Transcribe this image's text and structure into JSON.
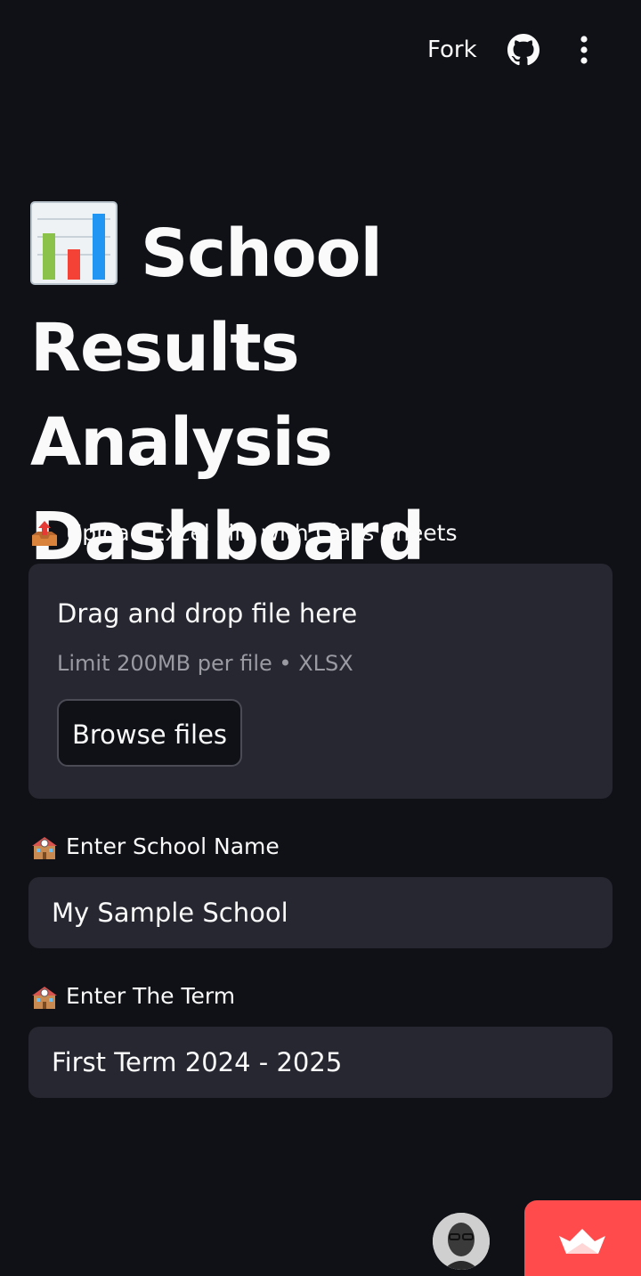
{
  "toolbar": {
    "fork_label": "Fork",
    "github_icon": "github-icon",
    "menu_icon": "kebab-menu-icon"
  },
  "title": {
    "icon": "bar-chart-icon",
    "text": "School Results Analysis Dashboard"
  },
  "upload": {
    "label_icon": "outbox-tray-icon",
    "label": "Upload Excel File with Class Sheets",
    "dropzone_title": "Drag and drop file here",
    "dropzone_hint": "Limit 200MB per file • XLSX",
    "browse_label": "Browse files"
  },
  "school_name": {
    "label_icon": "school-building-icon",
    "label": "Enter School Name",
    "value": "My Sample School"
  },
  "term": {
    "label_icon": "school-building-icon",
    "label": "Enter The Term",
    "value": "First Term 2024 - 2025"
  },
  "footer": {
    "avatar": "user-avatar",
    "badge_icon": "streamlit-crown-icon"
  },
  "colors": {
    "background": "#0f1117",
    "surface": "#262730",
    "text": "#fafafa",
    "muted_text": "#9a9aa3",
    "accent": "#ff4b4b"
  }
}
